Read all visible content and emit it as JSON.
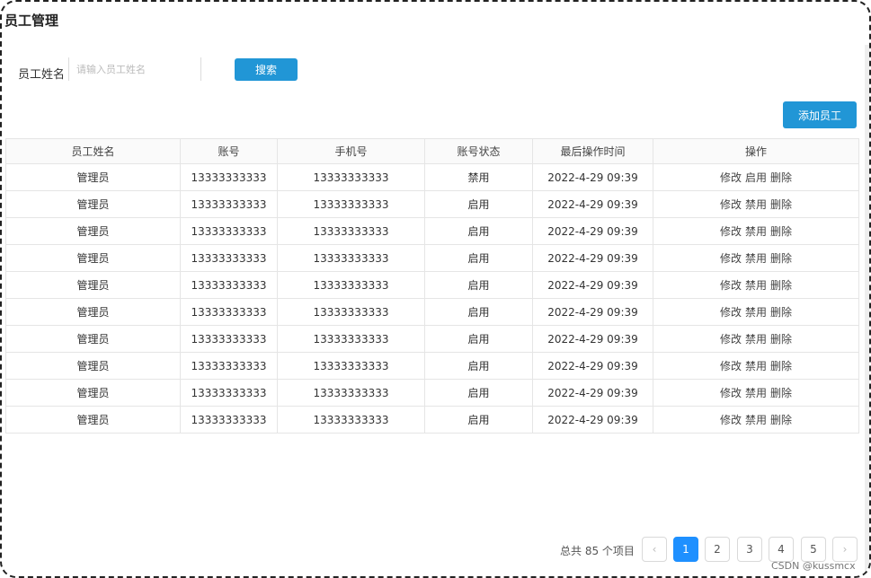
{
  "page": {
    "title": "员工管理"
  },
  "search": {
    "label": "员工姓名",
    "placeholder": "请输入员工姓名",
    "button_label": "搜索"
  },
  "toolbar": {
    "add_label": "添加员工"
  },
  "table": {
    "columns": [
      "员工姓名",
      "账号",
      "手机号",
      "账号状态",
      "最后操作时间",
      "操作"
    ],
    "rows": [
      {
        "name": "管理员",
        "account": "13333333333",
        "phone": "13333333333",
        "status": "禁用",
        "time": "2022-4-29 09:39",
        "ops": [
          "修改",
          "启用",
          "删除"
        ]
      },
      {
        "name": "管理员",
        "account": "13333333333",
        "phone": "13333333333",
        "status": "启用",
        "time": "2022-4-29 09:39",
        "ops": [
          "修改",
          "禁用",
          "删除"
        ]
      },
      {
        "name": "管理员",
        "account": "13333333333",
        "phone": "13333333333",
        "status": "启用",
        "time": "2022-4-29 09:39",
        "ops": [
          "修改",
          "禁用",
          "删除"
        ]
      },
      {
        "name": "管理员",
        "account": "13333333333",
        "phone": "13333333333",
        "status": "启用",
        "time": "2022-4-29 09:39",
        "ops": [
          "修改",
          "禁用",
          "删除"
        ]
      },
      {
        "name": "管理员",
        "account": "13333333333",
        "phone": "13333333333",
        "status": "启用",
        "time": "2022-4-29 09:39",
        "ops": [
          "修改",
          "禁用",
          "删除"
        ]
      },
      {
        "name": "管理员",
        "account": "13333333333",
        "phone": "13333333333",
        "status": "启用",
        "time": "2022-4-29 09:39",
        "ops": [
          "修改",
          "禁用",
          "删除"
        ]
      },
      {
        "name": "管理员",
        "account": "13333333333",
        "phone": "13333333333",
        "status": "启用",
        "time": "2022-4-29 09:39",
        "ops": [
          "修改",
          "禁用",
          "删除"
        ]
      },
      {
        "name": "管理员",
        "account": "13333333333",
        "phone": "13333333333",
        "status": "启用",
        "time": "2022-4-29 09:39",
        "ops": [
          "修改",
          "禁用",
          "删除"
        ]
      },
      {
        "name": "管理员",
        "account": "13333333333",
        "phone": "13333333333",
        "status": "启用",
        "time": "2022-4-29 09:39",
        "ops": [
          "修改",
          "禁用",
          "删除"
        ]
      },
      {
        "name": "管理员",
        "account": "13333333333",
        "phone": "13333333333",
        "status": "启用",
        "time": "2022-4-29 09:39",
        "ops": [
          "修改",
          "禁用",
          "删除"
        ]
      }
    ]
  },
  "pagination": {
    "total_text": "总共 85 个项目",
    "prev_icon": "chevron-left-icon",
    "next_icon": "chevron-right-icon",
    "pages": [
      "1",
      "2",
      "3",
      "4",
      "5"
    ],
    "current": "1"
  },
  "watermark": "CSDN @kussmcx",
  "colors": {
    "primary": "#2196d6",
    "active_page": "#1e90ff"
  }
}
